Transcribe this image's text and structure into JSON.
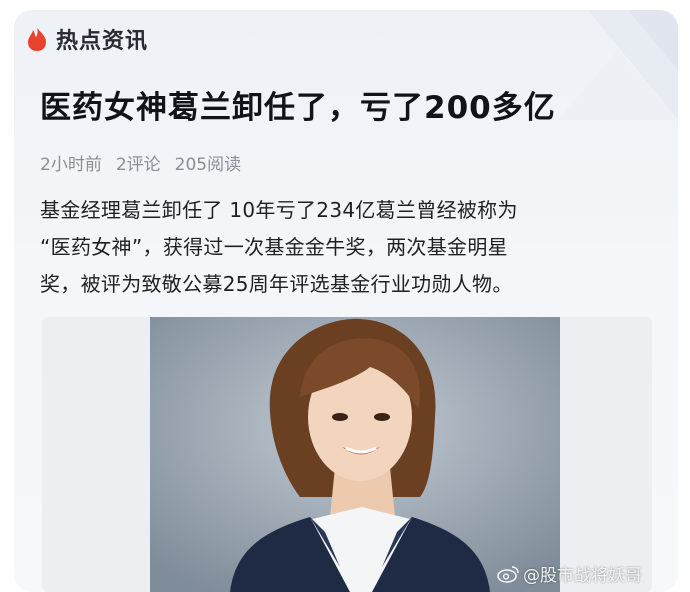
{
  "header": {
    "icon": "flame-icon",
    "title": "热点资讯"
  },
  "article": {
    "headline": "医药女神葛兰卸任了，亏了200多亿",
    "meta": {
      "time": "2小时前",
      "comments": "2评论",
      "reads": "205阅读"
    },
    "body_lines": [
      "基金经理葛兰卸任了 10年亏了234亿葛兰曾经被称为",
      "“医药女神”，获得过一次基金金牛奖，两次基金明星",
      "奖，被评为致敬公募25周年评选基金行业功勋人物。"
    ]
  },
  "image": {
    "subject": "portrait-photo"
  },
  "watermark": {
    "icon": "weibo-icon",
    "text": "@股市战将妖哥"
  },
  "colors": {
    "accent": "#e8432e",
    "card_bg": "#f3f5f8",
    "meta_text": "#8b8e96",
    "photo_bg": "#9aa6b3"
  }
}
